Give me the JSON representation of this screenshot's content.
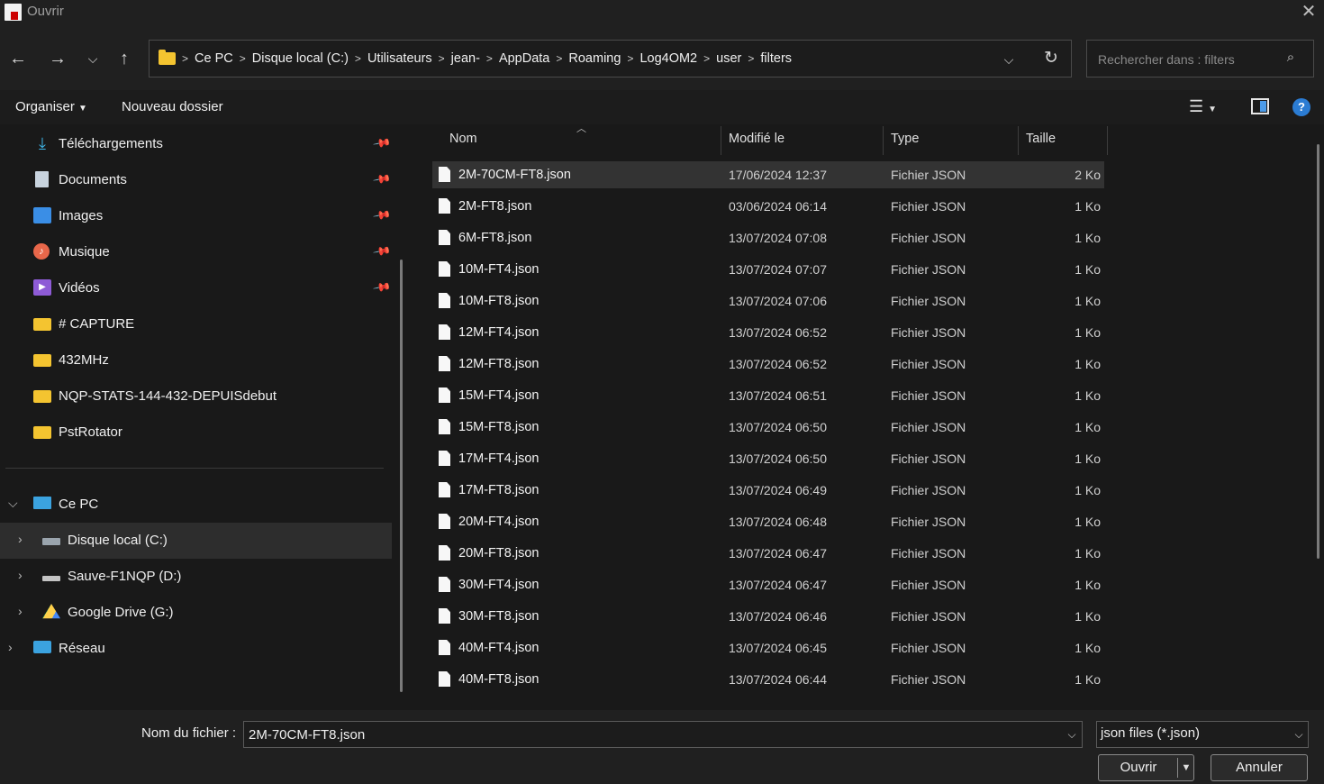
{
  "window": {
    "title": "Ouvrir"
  },
  "address": {
    "crumbs": [
      "Ce PC",
      "Disque local (C:)",
      "Utilisateurs",
      "jean-",
      "AppData",
      "Roaming",
      "Log4OM2",
      "user",
      "filters"
    ]
  },
  "search": {
    "placeholder": "Rechercher dans : filters"
  },
  "toolbar": {
    "organise": "Organiser",
    "new_folder": "Nouveau dossier"
  },
  "sidebar": {
    "quick": [
      {
        "label": "Téléchargements",
        "icon": "download-icon",
        "pinned": true
      },
      {
        "label": "Documents",
        "icon": "documents-icon",
        "pinned": true
      },
      {
        "label": "Images",
        "icon": "images-icon",
        "pinned": true
      },
      {
        "label": "Musique",
        "icon": "music-icon",
        "pinned": true
      },
      {
        "label": "Vidéos",
        "icon": "videos-icon",
        "pinned": true
      },
      {
        "label": "# CAPTURE",
        "icon": "folder-icon",
        "pinned": false
      },
      {
        "label": "432MHz",
        "icon": "folder-icon",
        "pinned": false
      },
      {
        "label": "NQP-STATS-144-432-DEPUISdebut",
        "icon": "folder-icon",
        "pinned": false
      },
      {
        "label": "PstRotator",
        "icon": "folder-icon",
        "pinned": false
      }
    ],
    "this_pc": "Ce PC",
    "drives": [
      "Disque local (C:)",
      "Sauve-F1NQP (D:)",
      "Google Drive (G:)"
    ],
    "network": "Réseau"
  },
  "columns": {
    "name": "Nom",
    "modified": "Modifié le",
    "type": "Type",
    "size": "Taille"
  },
  "files": [
    {
      "name": "2M-70CM-FT8.json",
      "date": "17/06/2024 12:37",
      "type": "Fichier JSON",
      "size": "2 Ko"
    },
    {
      "name": "2M-FT8.json",
      "date": "03/06/2024 06:14",
      "type": "Fichier JSON",
      "size": "1 Ko"
    },
    {
      "name": "6M-FT8.json",
      "date": "13/07/2024 07:08",
      "type": "Fichier JSON",
      "size": "1 Ko"
    },
    {
      "name": "10M-FT4.json",
      "date": "13/07/2024 07:07",
      "type": "Fichier JSON",
      "size": "1 Ko"
    },
    {
      "name": "10M-FT8.json",
      "date": "13/07/2024 07:06",
      "type": "Fichier JSON",
      "size": "1 Ko"
    },
    {
      "name": "12M-FT4.json",
      "date": "13/07/2024 06:52",
      "type": "Fichier JSON",
      "size": "1 Ko"
    },
    {
      "name": "12M-FT8.json",
      "date": "13/07/2024 06:52",
      "type": "Fichier JSON",
      "size": "1 Ko"
    },
    {
      "name": "15M-FT4.json",
      "date": "13/07/2024 06:51",
      "type": "Fichier JSON",
      "size": "1 Ko"
    },
    {
      "name": "15M-FT8.json",
      "date": "13/07/2024 06:50",
      "type": "Fichier JSON",
      "size": "1 Ko"
    },
    {
      "name": "17M-FT4.json",
      "date": "13/07/2024 06:50",
      "type": "Fichier JSON",
      "size": "1 Ko"
    },
    {
      "name": "17M-FT8.json",
      "date": "13/07/2024 06:49",
      "type": "Fichier JSON",
      "size": "1 Ko"
    },
    {
      "name": "20M-FT4.json",
      "date": "13/07/2024 06:48",
      "type": "Fichier JSON",
      "size": "1 Ko"
    },
    {
      "name": "20M-FT8.json",
      "date": "13/07/2024 06:47",
      "type": "Fichier JSON",
      "size": "1 Ko"
    },
    {
      "name": "30M-FT4.json",
      "date": "13/07/2024 06:47",
      "type": "Fichier JSON",
      "size": "1 Ko"
    },
    {
      "name": "30M-FT8.json",
      "date": "13/07/2024 06:46",
      "type": "Fichier JSON",
      "size": "1 Ko"
    },
    {
      "name": "40M-FT4.json",
      "date": "13/07/2024 06:45",
      "type": "Fichier JSON",
      "size": "1 Ko"
    },
    {
      "name": "40M-FT8.json",
      "date": "13/07/2024 06:44",
      "type": "Fichier JSON",
      "size": "1 Ko"
    }
  ],
  "footer": {
    "filename_label": "Nom du fichier :",
    "filename_value": "2M-70CM-FT8.json",
    "filetype": "json files (*.json)",
    "open": "Ouvrir",
    "cancel": "Annuler"
  },
  "colors": {
    "background": "#191919",
    "selected_row": "#333333",
    "folder": "#f4c430",
    "accent": "#2b7cd3"
  }
}
